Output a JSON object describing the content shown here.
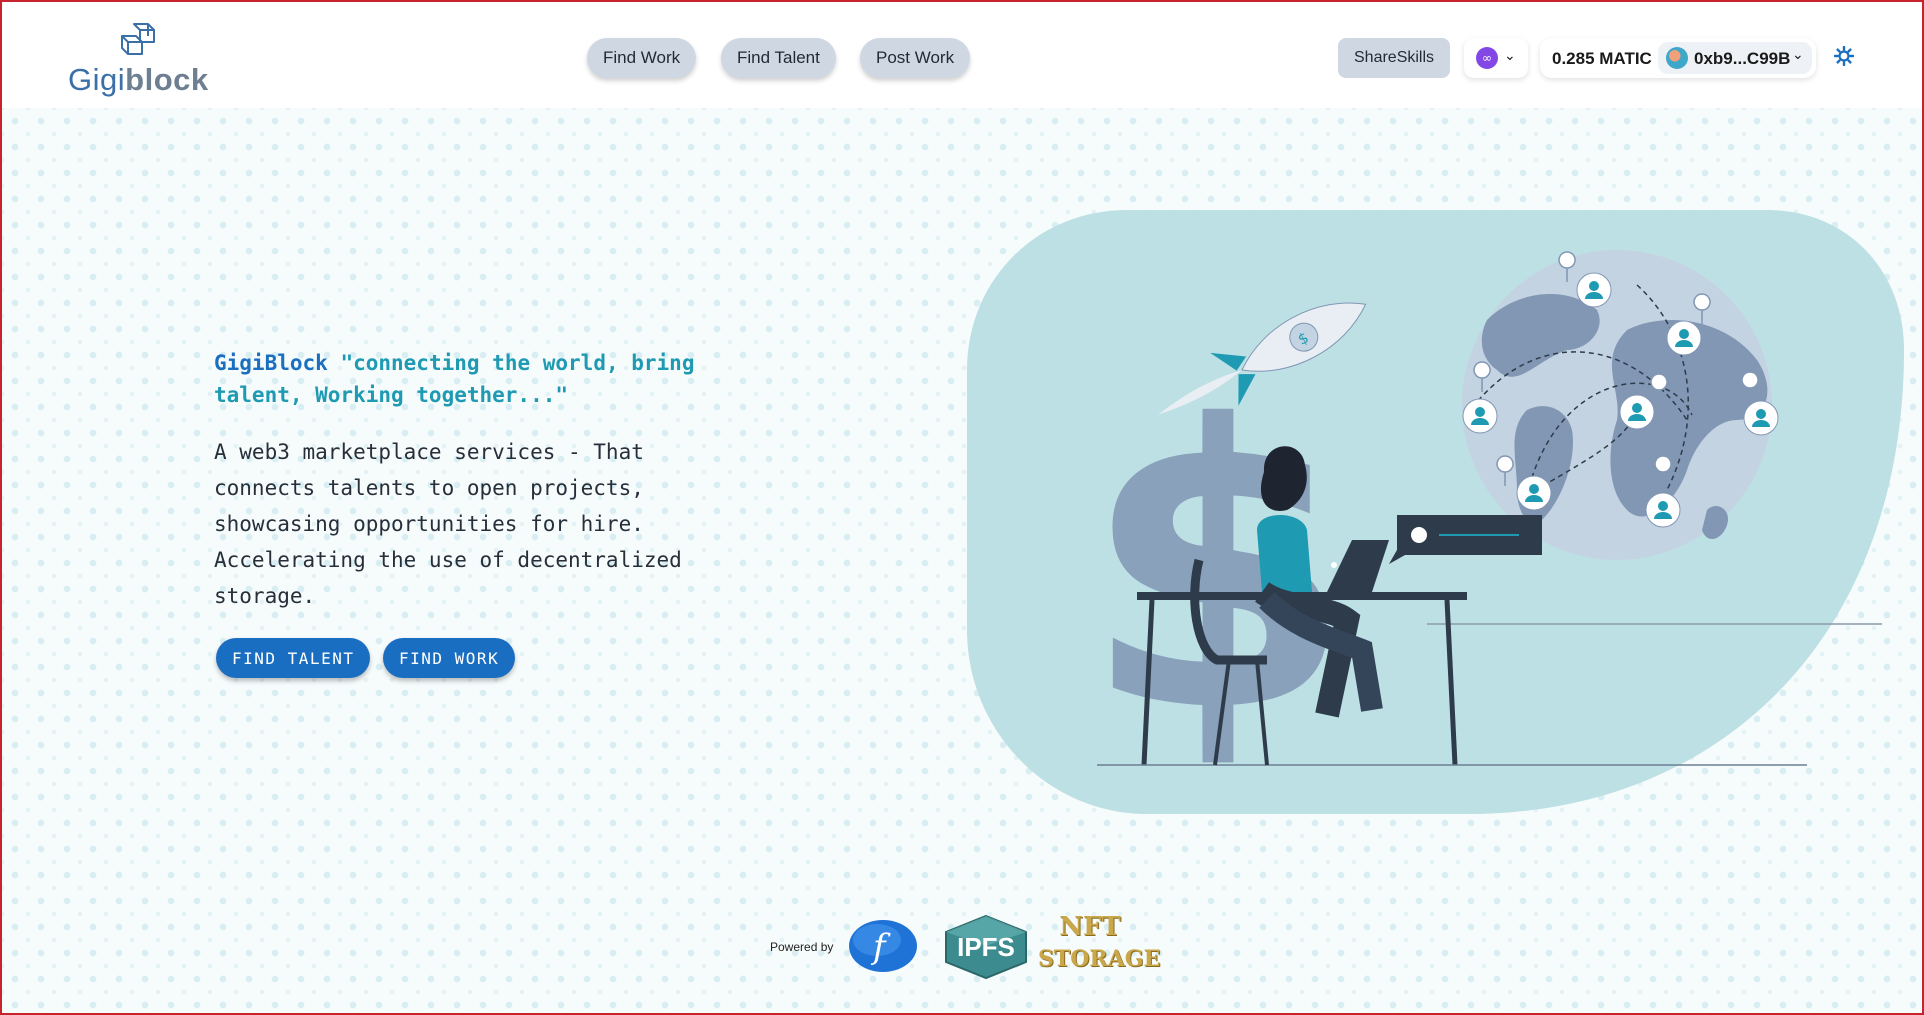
{
  "brand": {
    "logo_part1": "Gigi",
    "logo_part2": "block"
  },
  "nav": {
    "find_work": "Find Work",
    "find_talent": "Find Talent",
    "post_work": "Post Work"
  },
  "wallet": {
    "share_label": "ShareSkills",
    "chain_icon": "polygon-icon",
    "balance": "0.285 MATIC",
    "address": "0xb9...C99B"
  },
  "hero": {
    "brand_name": "GigiBlock",
    "tagline": "\"connecting the world, bring talent, Working together...\"",
    "description": "A web3 marketplace services - That connects talents to open projects, showcasing opportunities for hire. Accelerating the use of decentralized storage.",
    "find_talent_label": "FIND TALENT",
    "find_work_label": "FIND WORK"
  },
  "footer": {
    "powered_by": "Powered by",
    "filecoin_glyph": "f",
    "ipfs_label": "IPFS",
    "nft_line1": "NFT",
    "nft_line2": "STORAGE"
  },
  "colors": {
    "accent": "#1a6ec2",
    "tagline": "#1e9ab2",
    "nav_bg": "#cfd8e2",
    "illustration_bg": "#bde0e4"
  }
}
